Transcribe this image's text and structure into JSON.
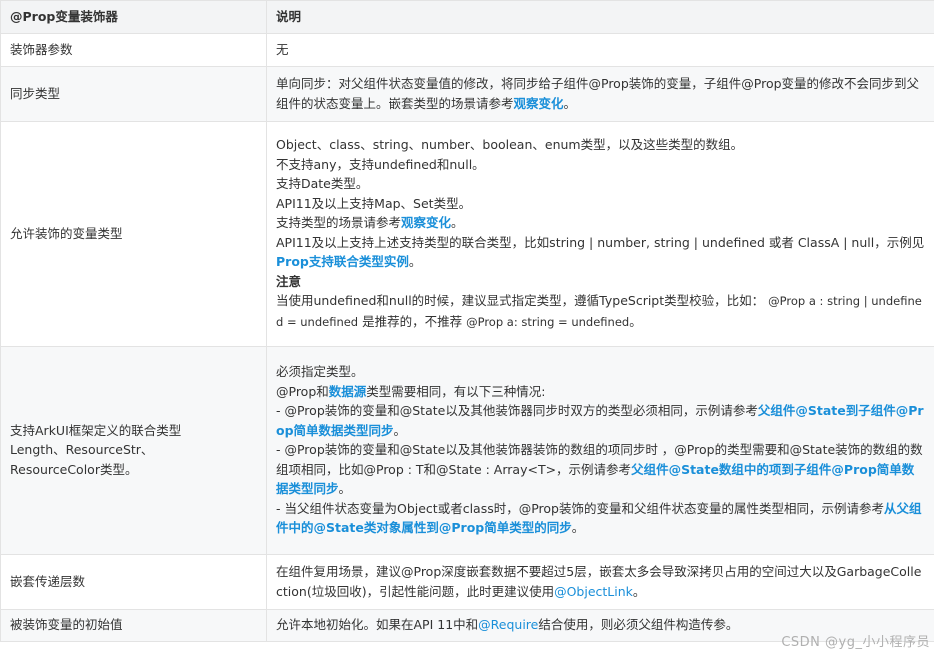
{
  "headers": {
    "col1": "@Prop变量装饰器",
    "col2": "说明"
  },
  "rows": [
    {
      "name": "装饰器参数",
      "lines": [
        "无"
      ]
    },
    {
      "name": "同步类型",
      "desc_pre": "单向同步：对父组件状态变量值的修改，将同步给子组件@Prop装饰的变量，子组件@Prop变量的修改不会同步到父组件的状态变量上。嵌套类型的场景请参考",
      "desc_link": "观察变化",
      "desc_post": "。"
    },
    {
      "name": "允许装饰的变量类型",
      "l1": "Object、class、string、number、boolean、enum类型，以及这些类型的数组。",
      "l2": "不支持any，支持undefined和null。",
      "l3": "支持Date类型。",
      "l4": "API11及以上支持Map、Set类型。",
      "l5_pre": "支持类型的场景请参考",
      "l5_link": "观察变化",
      "l5_post": "。",
      "l6_pre": "API11及以上支持上述支持类型的联合类型，比如string | number, string | undefined 或者 ClassA | null，示例见",
      "l6_link": "Prop支持联合类型实例",
      "l6_post": "。",
      "note_title": "注意",
      "note_pre": "当使用undefined和null的时候，建议显式指定类型，遵循TypeScript类型校验，比如：",
      "note_code1": "@Prop a : string | undefined = undefined",
      "note_mid": "是推荐的，不推荐",
      "note_code2": "@Prop a: string = undefined",
      "note_post": "。"
    },
    {
      "name_l1": "支持ArkUI框架定义的联合类型",
      "name_l2": "Length、ResourceStr、",
      "name_l3": "ResourceColor类型。",
      "l1": "必须指定类型。",
      "l2_pre": "@Prop和",
      "l2_link": "数据源",
      "l2_post": "类型需要相同，有以下三种情况:",
      "l3_pre": "- @Prop装饰的变量和@State以及其他装饰器同步时双方的类型必须相同，示例请参考",
      "l3_link": "父组件@State到子组件@Prop简单数据类型同步",
      "l3_post": "。",
      "l4_pre": "- @Prop装饰的变量和@State以及其他装饰器装饰的数组的项同步时 ，@Prop的类型需要和@State装饰的数组的数组项相同，比如@Prop : T和@State : Array<T>，示例请参考",
      "l4_link": "父组件@State数组中的项到子组件@Prop简单数据类型同步",
      "l4_post": "。",
      "l5_pre": "- 当父组件状态变量为Object或者class时，@Prop装饰的变量和父组件状态变量的属性类型相同，示例请参考",
      "l5_link": "从父组件中的@State类对象属性到@Prop简单类型的同步",
      "l5_post": "。"
    },
    {
      "name": "嵌套传递层数",
      "desc_pre": "在组件复用场景，建议@Prop深度嵌套数据不要超过5层，嵌套太多会导致深拷贝占用的空间过大以及GarbageCollection(垃圾回收)，引起性能问题，此时更建议使用",
      "desc_link": "@ObjectLink",
      "desc_post": "。"
    },
    {
      "name": "被装饰变量的初始值",
      "desc_pre": "允许本地初始化。如果在API 11中和",
      "desc_link": "@Require",
      "desc_post": "结合使用，则必须父组件构造传参。"
    }
  ],
  "watermark": "CSDN @yg_小小程序员",
  "colors": {
    "link": "#1a8fd9",
    "header_bg": "#f3f4f5",
    "alt_row_bg": "#f7f8f9",
    "border": "#e3e3e3"
  }
}
